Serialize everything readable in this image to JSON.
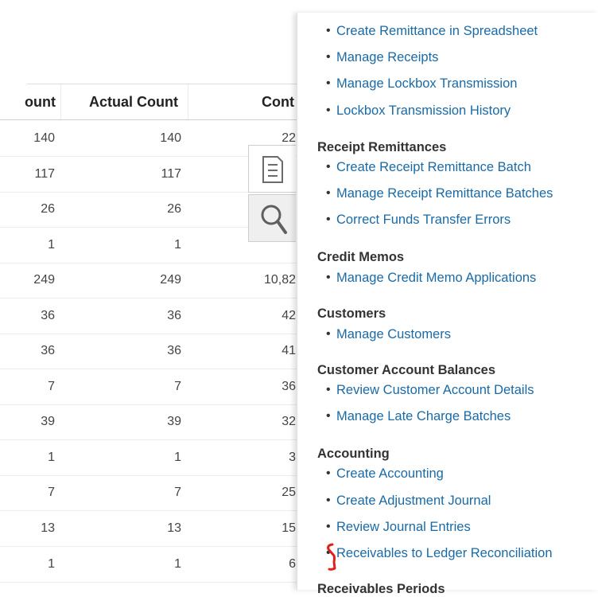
{
  "table": {
    "columns": [
      "ount",
      "Actual Count",
      "Cont"
    ],
    "rows": [
      {
        "count": "140",
        "actual": "140",
        "cont": "22"
      },
      {
        "count": "117",
        "actual": "117",
        "cont": ""
      },
      {
        "count": "26",
        "actual": "26",
        "cont": ""
      },
      {
        "count": "1",
        "actual": "1",
        "cont": ""
      },
      {
        "count": "249",
        "actual": "249",
        "cont": "10,82"
      },
      {
        "count": "36",
        "actual": "36",
        "cont": "42"
      },
      {
        "count": "36",
        "actual": "36",
        "cont": "41"
      },
      {
        "count": "7",
        "actual": "7",
        "cont": "36"
      },
      {
        "count": "39",
        "actual": "39",
        "cont": "32"
      },
      {
        "count": "1",
        "actual": "1",
        "cont": "3"
      },
      {
        "count": "7",
        "actual": "7",
        "cont": "25"
      },
      {
        "count": "13",
        "actual": "13",
        "cont": "15"
      },
      {
        "count": "1",
        "actual": "1",
        "cont": "6"
      }
    ]
  },
  "task_panel": {
    "receipts_links": [
      "Create Remittance in Spreadsheet",
      "Manage Receipts",
      "Manage Lockbox Transmission",
      "Lockbox Transmission History"
    ],
    "receipt_remittances": {
      "title": "Receipt Remittances",
      "links": [
        "Create Receipt Remittance Batch",
        "Manage Receipt Remittance Batches",
        "Correct Funds Transfer Errors"
      ]
    },
    "credit_memos": {
      "title": "Credit Memos",
      "links": [
        "Manage Credit Memo Applications"
      ]
    },
    "customers": {
      "title": "Customers",
      "links": [
        "Manage Customers"
      ]
    },
    "customer_account_balances": {
      "title": "Customer Account Balances",
      "links": [
        "Review Customer Account Details",
        "Manage Late Charge Batches"
      ]
    },
    "accounting": {
      "title": "Accounting",
      "links": [
        "Create Accounting",
        "Create Adjustment Journal",
        "Review Journal Entries",
        "Receivables to Ledger Reconciliation"
      ]
    },
    "receivables_periods": {
      "title": "Receivables Periods"
    }
  },
  "colors": {
    "link": "#1a6aa5",
    "annotation": "#e0201c"
  },
  "icons": [
    "document-icon",
    "search-icon"
  ]
}
